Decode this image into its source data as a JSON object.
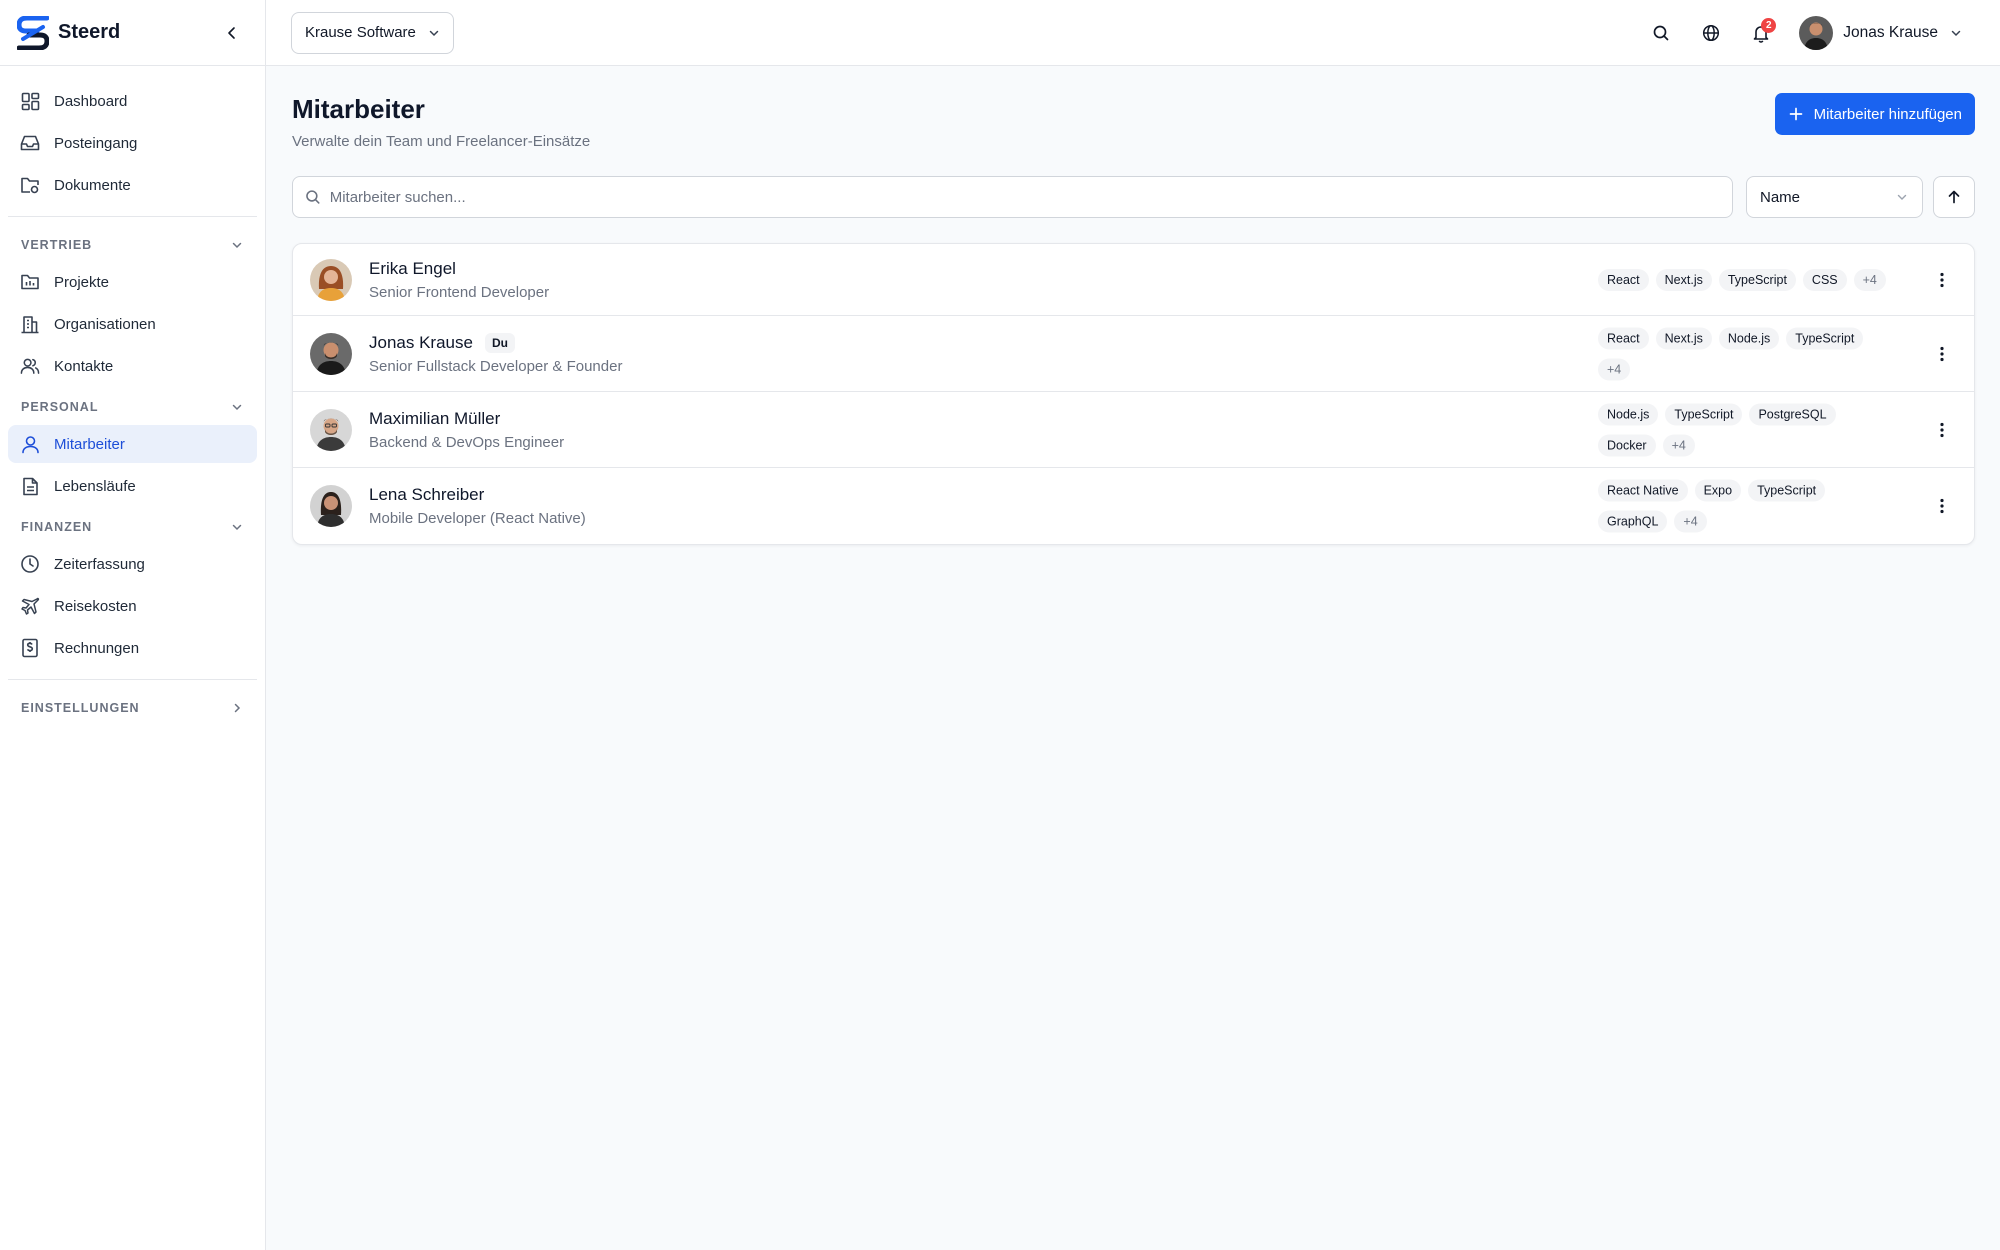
{
  "brand": {
    "name": "Steerd",
    "accent": "#1a63f0"
  },
  "sidebar": {
    "top_items": [
      {
        "label": "Dashboard",
        "icon": "dashboard-icon"
      },
      {
        "label": "Posteingang",
        "icon": "inbox-icon"
      },
      {
        "label": "Dokumente",
        "icon": "folder-icon"
      }
    ],
    "sections": [
      {
        "title": "VERTRIEB",
        "expanded": true,
        "items": [
          {
            "label": "Projekte",
            "icon": "project-folder-icon"
          },
          {
            "label": "Organisationen",
            "icon": "building-icon"
          },
          {
            "label": "Kontakte",
            "icon": "contacts-icon"
          }
        ]
      },
      {
        "title": "PERSONAL",
        "expanded": true,
        "items": [
          {
            "label": "Mitarbeiter",
            "icon": "user-icon",
            "active": true
          },
          {
            "label": "Lebensläufe",
            "icon": "document-icon"
          }
        ]
      },
      {
        "title": "FINANZEN",
        "expanded": true,
        "items": [
          {
            "label": "Zeiterfassung",
            "icon": "clock-icon"
          },
          {
            "label": "Reisekosten",
            "icon": "plane-icon"
          },
          {
            "label": "Rechnungen",
            "icon": "invoice-icon"
          }
        ]
      },
      {
        "title": "EINSTELLUNGEN",
        "expanded": false,
        "items": []
      }
    ]
  },
  "topbar": {
    "org_name": "Krause Software",
    "notification_count": "2",
    "user_name": "Jonas Krause"
  },
  "page": {
    "title": "Mitarbeiter",
    "subtitle": "Verwalte dein Team und Freelancer-Einsätze",
    "add_button": "Mitarbeiter hinzufügen",
    "search_placeholder": "Mitarbeiter suchen...",
    "sort_value": "Name"
  },
  "employees": [
    {
      "name": "Erika Engel",
      "role": "Senior Frontend Developer",
      "badge": "",
      "skills": [
        "React",
        "Next.js",
        "TypeScript",
        "CSS"
      ],
      "more": "+4"
    },
    {
      "name": "Jonas Krause",
      "role": "Senior Fullstack Developer & Founder",
      "badge": "Du",
      "skills": [
        "React",
        "Next.js",
        "Node.js",
        "TypeScript"
      ],
      "more": "+4"
    },
    {
      "name": "Maximilian Müller",
      "role": "Backend & DevOps Engineer",
      "badge": "",
      "skills": [
        "Node.js",
        "TypeScript",
        "PostgreSQL",
        "Docker"
      ],
      "more": "+4"
    },
    {
      "name": "Lena Schreiber",
      "role": "Mobile Developer (React Native)",
      "badge": "",
      "skills": [
        "React Native",
        "Expo",
        "TypeScript",
        "GraphQL"
      ],
      "more": "+4"
    }
  ]
}
